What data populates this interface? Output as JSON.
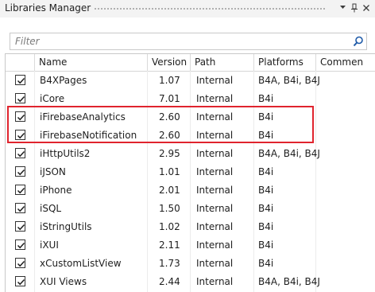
{
  "window": {
    "title": "Libraries Manager"
  },
  "search": {
    "placeholder": "Filter"
  },
  "columns": {
    "name": "Name",
    "version": "Version",
    "path": "Path",
    "platforms": "Platforms",
    "comments": "Commen"
  },
  "rows": [
    {
      "checked": true,
      "name": "B4XPages",
      "version": "1.07",
      "path": "Internal",
      "platforms": "B4A, B4i, B4J"
    },
    {
      "checked": true,
      "name": "iCore",
      "version": "7.01",
      "path": "Internal",
      "platforms": "B4i"
    },
    {
      "checked": true,
      "name": "iFirebaseAnalytics",
      "version": "2.60",
      "path": "Internal",
      "platforms": "B4i"
    },
    {
      "checked": true,
      "name": "iFirebaseNotification",
      "version": "2.60",
      "path": "Internal",
      "platforms": "B4i"
    },
    {
      "checked": true,
      "name": "iHttpUtils2",
      "version": "2.95",
      "path": "Internal",
      "platforms": "B4A, B4i, B4J"
    },
    {
      "checked": true,
      "name": "iJSON",
      "version": "1.01",
      "path": "Internal",
      "platforms": "B4i"
    },
    {
      "checked": true,
      "name": "iPhone",
      "version": "2.01",
      "path": "Internal",
      "platforms": "B4i"
    },
    {
      "checked": true,
      "name": "iSQL",
      "version": "1.50",
      "path": "Internal",
      "platforms": "B4i"
    },
    {
      "checked": true,
      "name": "iStringUtils",
      "version": "1.02",
      "path": "Internal",
      "platforms": "B4i"
    },
    {
      "checked": true,
      "name": "iXUI",
      "version": "2.11",
      "path": "Internal",
      "platforms": "B4i"
    },
    {
      "checked": true,
      "name": "xCustomListView",
      "version": "1.73",
      "path": "Internal",
      "platforms": "B4i"
    },
    {
      "checked": true,
      "name": "XUI Views",
      "version": "2.44",
      "path": "Internal",
      "platforms": "B4A, B4i, B4J"
    }
  ],
  "colors": {
    "highlight": "#e0242e",
    "border": "#c9c9c9"
  },
  "icons": {
    "dropdown": "chevron-down-icon",
    "pin": "pin-icon",
    "close": "close-icon",
    "search": "search-icon",
    "check": "check-icon"
  }
}
